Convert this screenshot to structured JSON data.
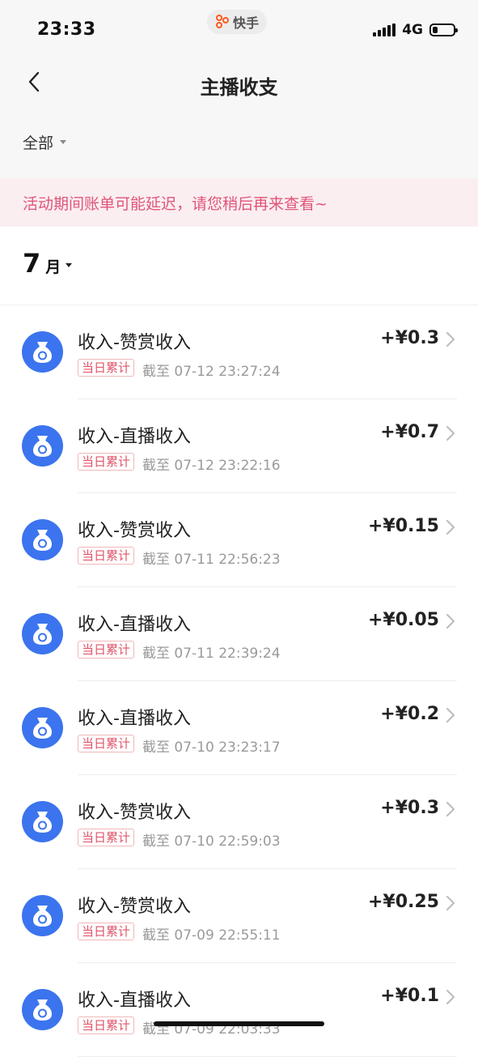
{
  "status_bar": {
    "time": "23:33",
    "app_name": "快手",
    "network": "4G",
    "battery_level": 0.25
  },
  "header": {
    "title": "主播收支",
    "back_icon": "chevron-left-icon"
  },
  "filter": {
    "label": "全部"
  },
  "notice": {
    "text": "活动期间账单可能延迟，请您稍后再来查看~"
  },
  "month_selector": {
    "number": "7",
    "unit": "月"
  },
  "colors": {
    "accent_blue": "#3b74ee",
    "notice_text": "#e0557a",
    "notice_bg": "#fbeef0",
    "brand_orange": "#ff5a1f"
  },
  "transactions": [
    {
      "title": "收入-赞赏收入",
      "tag": "当日累计",
      "time": "截至 07-12 23:27:24",
      "amount": "+¥0.3"
    },
    {
      "title": "收入-直播收入",
      "tag": "当日累计",
      "time": "截至 07-12 23:22:16",
      "amount": "+¥0.7"
    },
    {
      "title": "收入-赞赏收入",
      "tag": "当日累计",
      "time": "截至 07-11 22:56:23",
      "amount": "+¥0.15"
    },
    {
      "title": "收入-直播收入",
      "tag": "当日累计",
      "time": "截至 07-11 22:39:24",
      "amount": "+¥0.05"
    },
    {
      "title": "收入-直播收入",
      "tag": "当日累计",
      "time": "截至 07-10 23:23:17",
      "amount": "+¥0.2"
    },
    {
      "title": "收入-赞赏收入",
      "tag": "当日累计",
      "time": "截至 07-10 22:59:03",
      "amount": "+¥0.3"
    },
    {
      "title": "收入-赞赏收入",
      "tag": "当日累计",
      "time": "截至 07-09 22:55:11",
      "amount": "+¥0.25"
    },
    {
      "title": "收入-直播收入",
      "tag": "当日累计",
      "time": "截至 07-09 22:03:33",
      "amount": "+¥0.1"
    }
  ]
}
